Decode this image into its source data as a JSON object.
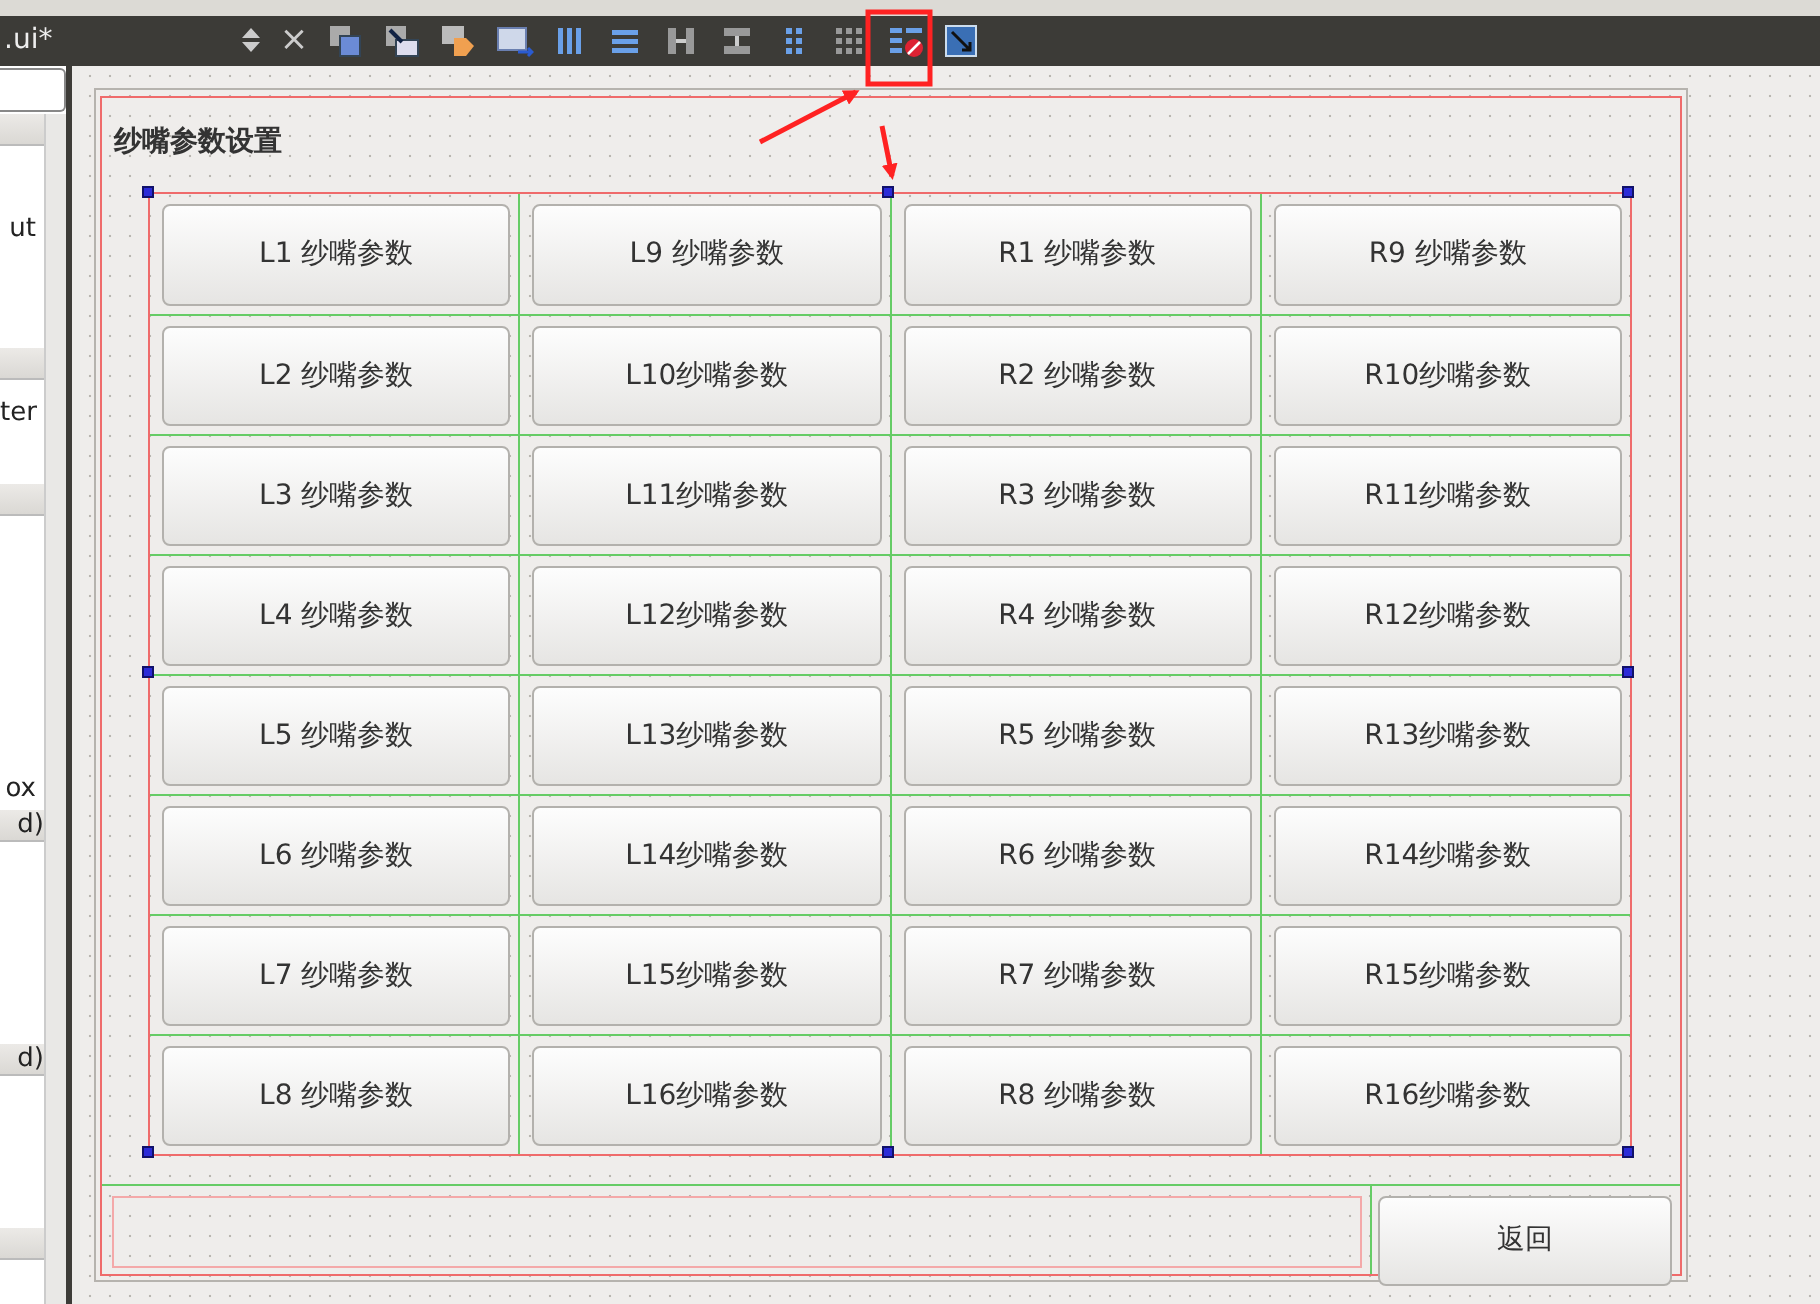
{
  "toolbar": {
    "file_combo": ".ui*",
    "close": "×"
  },
  "side_panel": {
    "items": [
      {
        "kind": "field"
      },
      {
        "kind": "header"
      },
      {
        "kind": "text",
        "text": "ut"
      },
      {
        "kind": "header"
      },
      {
        "kind": "text",
        "text": "ter"
      },
      {
        "kind": "header"
      },
      {
        "kind": "text",
        "text": "ox"
      },
      {
        "kind": "header",
        "text": "d)"
      },
      {
        "kind": "header",
        "text": "d)"
      },
      {
        "kind": "header"
      }
    ]
  },
  "form": {
    "title": "纱嘴参数设置",
    "grid_rows": [
      [
        "L1 纱嘴参数",
        "L9 纱嘴参数",
        "R1 纱嘴参数",
        "R9 纱嘴参数"
      ],
      [
        "L2 纱嘴参数",
        "L10纱嘴参数",
        "R2 纱嘴参数",
        "R10纱嘴参数"
      ],
      [
        "L3 纱嘴参数",
        "L11纱嘴参数",
        "R3 纱嘴参数",
        "R11纱嘴参数"
      ],
      [
        "L4 纱嘴参数",
        "L12纱嘴参数",
        "R4 纱嘴参数",
        "R12纱嘴参数"
      ],
      [
        "L5 纱嘴参数",
        "L13纱嘴参数",
        "R5 纱嘴参数",
        "R13纱嘴参数"
      ],
      [
        "L6 纱嘴参数",
        "L14纱嘴参数",
        "R6 纱嘴参数",
        "R14纱嘴参数"
      ],
      [
        "L7 纱嘴参数",
        "L15纱嘴参数",
        "R7 纱嘴参数",
        "R15纱嘴参数"
      ],
      [
        "L8 纱嘴参数",
        "L16纱嘴参数",
        "R8 纱嘴参数",
        "R16纱嘴参数"
      ]
    ],
    "back_button": "返回"
  }
}
